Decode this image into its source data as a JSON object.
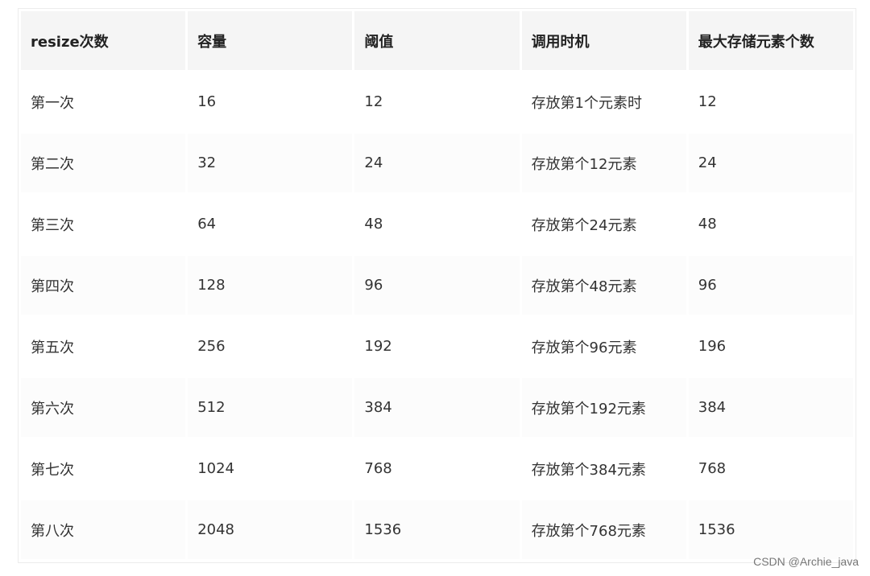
{
  "table": {
    "headers": [
      "resize次数",
      "容量",
      "阈值",
      "调用时机",
      "最大存储元素个数"
    ],
    "rows": [
      [
        "第一次",
        "16",
        "12",
        "存放第1个元素时",
        "12"
      ],
      [
        "第二次",
        "32",
        "24",
        "存放第个12元素",
        "24"
      ],
      [
        "第三次",
        "64",
        "48",
        "存放第个24元素",
        "48"
      ],
      [
        "第四次",
        "128",
        "96",
        "存放第个48元素",
        "96"
      ],
      [
        "第五次",
        "256",
        "192",
        "存放第个96元素",
        "196"
      ],
      [
        "第六次",
        "512",
        "384",
        "存放第个192元素",
        "384"
      ],
      [
        "第七次",
        "1024",
        "768",
        "存放第个384元素",
        "768"
      ],
      [
        "第八次",
        "2048",
        "1536",
        "存放第个768元素",
        "1536"
      ]
    ]
  },
  "watermark": "CSDN @Archie_java"
}
